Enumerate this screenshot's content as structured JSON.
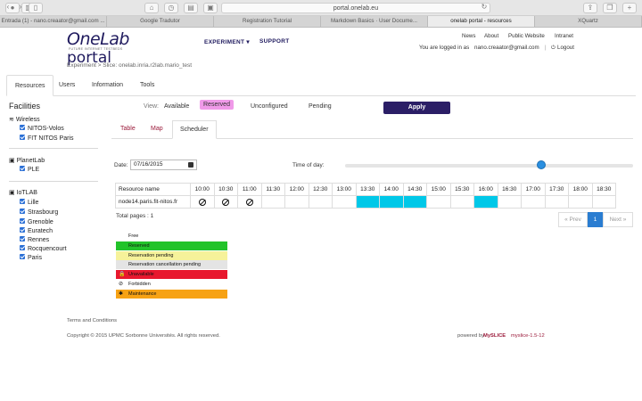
{
  "browser": {
    "url": "portal.onelab.eu",
    "tabs": [
      "Entrada (1) - nano.creaator@gmail.com ...",
      "Google Tradutor",
      "Registration Tutorial",
      "Markdown Basics · User Docume...",
      "onelab portal - resources",
      "XQuartz"
    ],
    "active_tab": 4
  },
  "header": {
    "logo_one": "OneLab",
    "logo_portal": "portal",
    "logo_tag": "FUTURE INTERNET TESTBEDS",
    "nav_experiment": "EXPERIMENT ▾",
    "nav_support": "SUPPORT",
    "link_news": "News",
    "link_about": "About",
    "link_public": "Public Website",
    "link_intranet": "Intranet",
    "logged_in": "You are logged in as",
    "user_email": "nano.creaator@gmail.com",
    "logout": "Logout"
  },
  "breadcrumb": {
    "text": "Experiment  >  Slice: onelab.inria.r2lab.mario_test"
  },
  "page_tabs": [
    "Resources",
    "Users",
    "Information",
    "Tools"
  ],
  "facilities": {
    "title": "Facilities",
    "groups": [
      {
        "name": "Wireless",
        "items": [
          "NITOS-Volos",
          "FIT NITOS Paris"
        ]
      },
      {
        "name": "PlanetLab",
        "items": [
          "PLE"
        ]
      },
      {
        "name": "IoTLAB",
        "items": [
          "Lille",
          "Strasbourg",
          "Grenoble",
          "Euratech",
          "Rennes",
          "Rocquencourt",
          "Paris"
        ]
      }
    ]
  },
  "view": {
    "label": "View:",
    "options": [
      "Available",
      "Reserved",
      "Unconfigured",
      "Pending"
    ],
    "apply": "Apply"
  },
  "sub_tabs": [
    "Table",
    "Map",
    "Scheduler"
  ],
  "scheduler": {
    "date_label": "Date:",
    "date_value": "07/16/2015",
    "time_label": "Time of day:",
    "time_of_day_fraction": 0.68,
    "resource_header": "Resource name",
    "times": [
      "10:00",
      "10:30",
      "11:00",
      "11:30",
      "12:00",
      "12:30",
      "13:00",
      "13:30",
      "14:00",
      "14:30",
      "15:00",
      "15:30",
      "16:00",
      "16:30",
      "17:00",
      "17:30",
      "18:00",
      "18:30"
    ],
    "rows": [
      {
        "name": "node14.paris.fit-nitos.fr",
        "slots": [
          "forbidden",
          "forbidden",
          "forbidden",
          "free",
          "free",
          "free",
          "free",
          "reserved",
          "reserved",
          "reserved",
          "free",
          "free",
          "reserved",
          "free",
          "free",
          "free",
          "free",
          "free"
        ]
      }
    ],
    "total_pages": "Total pages : 1",
    "prev": "« Prev",
    "page": "1",
    "next": "Next »"
  },
  "legend": [
    {
      "label": "Free",
      "color": "#ffffff",
      "icon": ""
    },
    {
      "label": "Reserved",
      "color": "#22c32a",
      "icon": ""
    },
    {
      "label": "Reservation pending",
      "color": "#f6f29a",
      "icon": ""
    },
    {
      "label": "Reservation cancellation pending",
      "color": "#e4e4e4",
      "icon": ""
    },
    {
      "label": "Unavailable",
      "color": "#e8182e",
      "icon": "lock-icon"
    },
    {
      "label": "Forbidden",
      "color": "#ffffff",
      "icon": "forbidden-icon"
    },
    {
      "label": "Maintenance",
      "color": "#f7a214",
      "icon": "wrench-icon"
    }
  ],
  "footer": {
    "terms": "Terms and Conditions",
    "copyright": "Copyright © 2015 UPMC Sorbonne Universités. All rights reserved.",
    "powered": "powered by",
    "myslice": "MySLICE",
    "version": "myslice-1.5-12"
  }
}
